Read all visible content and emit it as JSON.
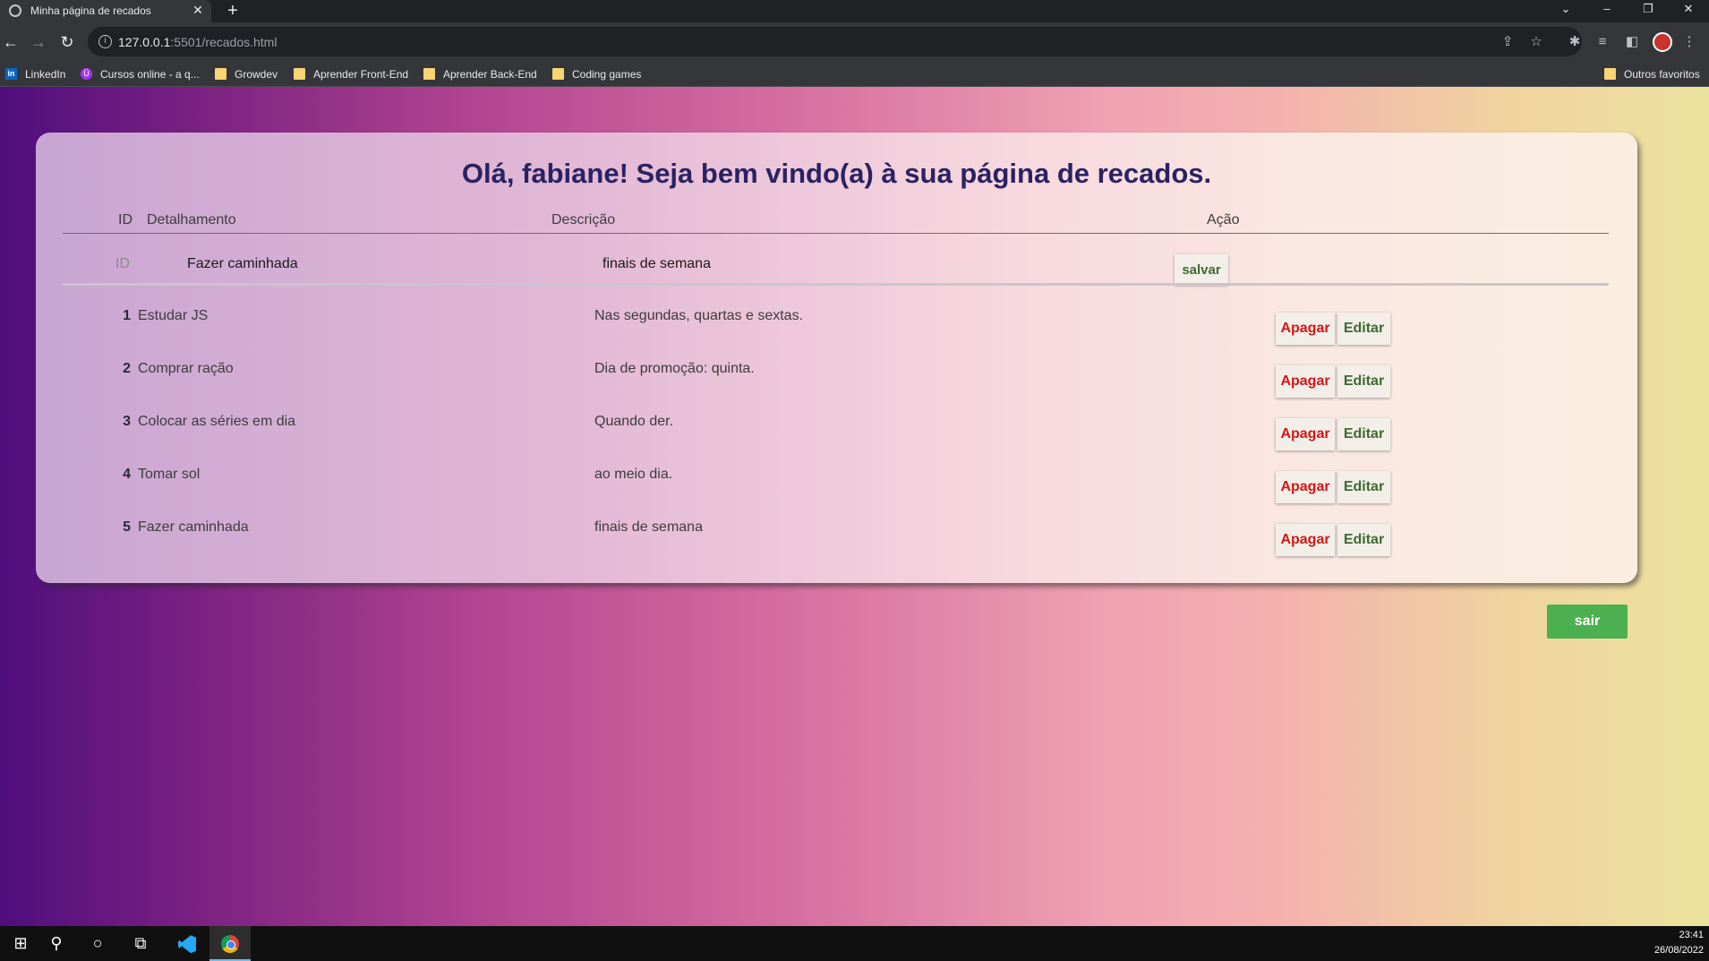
{
  "browser": {
    "tab_title": "Minha página de recados",
    "url_host": "127.0.0.1",
    "url_path": ":5501/recados.html"
  },
  "bookmarks": [
    {
      "label": "LinkedIn",
      "icon": "linkedin-icon"
    },
    {
      "label": "Cursos online - a q...",
      "icon": "udemy-icon"
    },
    {
      "label": "Growdev",
      "icon": "folder-icon"
    },
    {
      "label": "Aprender Front-End",
      "icon": "folder-icon"
    },
    {
      "label": "Aprender Back-End",
      "icon": "folder-icon"
    },
    {
      "label": "Coding games",
      "icon": "folder-icon"
    }
  ],
  "other_bookmarks": "Outros favoritos",
  "page": {
    "heading": "Olá, fabiane! Seja bem vindo(a) à sua página de recados.",
    "columns": {
      "id": "ID",
      "detail": "Detalhamento",
      "description": "Descrição",
      "action": "Ação"
    },
    "form": {
      "id_placeholder": "ID",
      "detail_value": "Fazer caminhada",
      "description_value": "finais de semana",
      "save_label": "salvar"
    },
    "rows": [
      {
        "id": "1",
        "detail": "Estudar JS",
        "description": "Nas segundas, quartas e sextas."
      },
      {
        "id": "2",
        "detail": "Comprar ração",
        "description": "Dia de promoção: quinta."
      },
      {
        "id": "3",
        "detail": "Colocar as séries em dia",
        "description": "Quando der."
      },
      {
        "id": "4",
        "detail": "Tomar sol",
        "description": "ao meio dia."
      },
      {
        "id": "5",
        "detail": "Fazer caminhada",
        "description": "finais de semana"
      }
    ],
    "delete_label": "Apagar",
    "edit_label": "Editar",
    "logout_label": "sair"
  },
  "taskbar": {
    "time": "23:41",
    "date": "26/08/2022"
  },
  "colors": {
    "heading": "#2a2262",
    "delete": "#d01818",
    "edit": "#3e6a30",
    "logout_bg": "#4caf50"
  }
}
